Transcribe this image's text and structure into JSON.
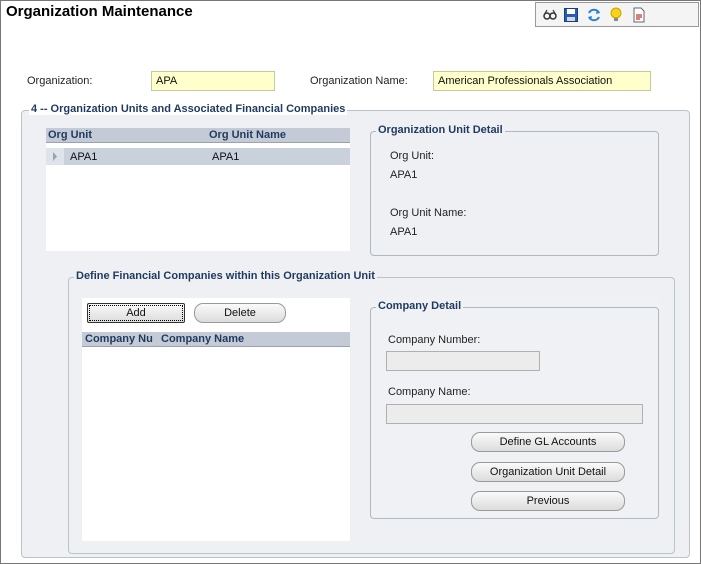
{
  "window": {
    "title": "Organization Maintenance"
  },
  "toolbar": {
    "icons": [
      "glasses-icon",
      "save-icon",
      "refresh-icon",
      "lightbulb-icon",
      "report-icon"
    ]
  },
  "header": {
    "organization_label": "Organization:",
    "organization_value": "APA",
    "organization_name_label": "Organization Name:",
    "organization_name_value": "American Professionals Association"
  },
  "org_units_group": {
    "title": "4 -- Organization Units and Associated Financial Companies",
    "grid": {
      "columns": [
        "Org Unit",
        "Org Unit Name"
      ],
      "rows": [
        {
          "org_unit": "APA1",
          "org_unit_name": "APA1"
        }
      ]
    },
    "detail": {
      "title": "Organization Unit Detail",
      "org_unit_label": "Org Unit:",
      "org_unit_value": "APA1",
      "org_unit_name_label": "Org Unit Name:",
      "org_unit_name_value": "APA1"
    }
  },
  "financial_group": {
    "title": "Define Financial Companies within this Organization Unit",
    "add_label": "Add",
    "delete_label": "Delete",
    "grid": {
      "columns": [
        "Company Nu",
        "Company Name"
      ],
      "rows": []
    },
    "company_detail": {
      "title": "Company Detail",
      "company_number_label": "Company Number:",
      "company_number_value": "",
      "company_name_label": "Company Name:",
      "company_name_value": "",
      "define_gl_label": "Define GL Accounts",
      "org_unit_detail_label": "Organization Unit Detail",
      "previous_label": "Previous"
    }
  }
}
